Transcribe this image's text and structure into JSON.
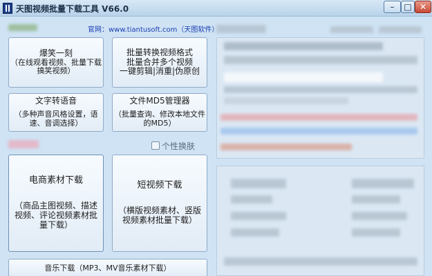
{
  "window": {
    "title": "天图视频批量下载工具 V66.0",
    "min_glyph": "–",
    "max_glyph": "□",
    "close_glyph": "✕"
  },
  "header": {
    "site_prefix": "官网：",
    "site_url": "www.tiantusoft.com",
    "site_suffix": "（天图软件）"
  },
  "buttons": {
    "b1": [
      "爆笑一刻",
      "（在线观看视频、批量下载",
      "搞笑视频）"
    ],
    "b2": [
      "批量转换视频格式",
      "批量合并多个视频",
      "一键剪辑|消重|伪原创"
    ],
    "b3": [
      "文字转语音",
      "",
      "（多种声音风格设置，语",
      "速、音调选择）"
    ],
    "b4": [
      "文件MD5管理器",
      "",
      "（批量查询、修改本地文件",
      "的MD5）"
    ],
    "b5": [
      "电商素材下载",
      "",
      "（商品主图视频、描述",
      "视频、评论视频素材批",
      "量下载）"
    ],
    "b6": [
      "短视频下载",
      "",
      "（横版视频素材、竖版",
      "视频素材批量下载）"
    ],
    "b7": [
      "音乐下载（MP3、MV音乐素材下载）"
    ]
  },
  "skin_label": "个性换肤"
}
